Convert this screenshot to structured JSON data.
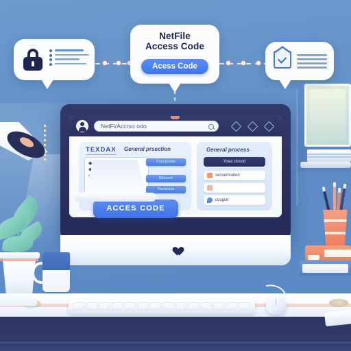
{
  "scene": {
    "title": "NetFile Access Code desk illustration",
    "colors": {
      "wall": "#6292c8",
      "bezel": "#2b3060",
      "accent_blue": "#4a7ce6",
      "dark_navy": "#20264f",
      "coral": "#ea7f5d",
      "leaf_green": "#7fcbbb"
    }
  },
  "callouts": {
    "left": {
      "name": "lock-document-callout",
      "lock_icon": "lock-icon",
      "doc_icon": "document-lines-icon"
    },
    "center": {
      "title_line_1": "NetFile",
      "title_line_2": "Access Code",
      "button_label": "Acess Code"
    },
    "right": {
      "name": "envelope-check-callout",
      "envelope_icon": "envelope-check-icon",
      "lines_icon": "text-lines-icon"
    }
  },
  "monitor": {
    "browser": {
      "avatar_icon": "user-avatar-icon",
      "url_value": "NetFi/Accrso odo",
      "url_placeholder": "Search",
      "search_icon": "search-icon",
      "toolbar_icons": [
        "diamond-icon",
        "diamond-icon",
        "diamond-icon"
      ]
    },
    "screen": {
      "left_panel": {
        "logo": "TEXDAX",
        "heading": "General prsection",
        "rows": [
          {
            "icon": "bullet-icon",
            "line": "short"
          },
          {
            "icon": "bullet-icon",
            "line": "long"
          },
          {
            "icon": "bullet-icon",
            "line": "mid"
          },
          {
            "icon": "bullet-icon",
            "line": "short"
          },
          {
            "icon": "bullet-icon",
            "line": "mid"
          }
        ],
        "buttons": [
          {
            "label": "Prauquotes"
          },
          {
            "label": "Gdooore"
          },
          {
            "label": "Porntotcts"
          }
        ]
      },
      "right_panel": {
        "heading": "General process",
        "primary_button": "Yoaa closod",
        "rows": [
          {
            "icon": "note-icon",
            "label": "servietmation",
            "color": "#ef9a73"
          },
          {
            "icon": "door-icon",
            "label": "",
            "color": "#e8b79e"
          },
          {
            "icon": "droplet-icon",
            "label": "cougial",
            "color": "#5d8fd6"
          }
        ]
      }
    },
    "cta_label": "ACCES CODE",
    "logo_icon": "heart-icon"
  },
  "desk": {
    "keyboard": {
      "name": "keyboard",
      "key_count": 14
    },
    "mouse": {
      "name": "computer-mouse"
    },
    "mug": {
      "name": "coffee-mug"
    },
    "coaster": {
      "name": "coaster"
    },
    "plant": {
      "name": "potted-plant"
    },
    "lamp": {
      "name": "desk-lamp"
    },
    "pencil_cup": {
      "name": "pencil-cup",
      "pencil_count": 4
    },
    "books": [
      {
        "name": "book-blue"
      },
      {
        "name": "book-coral"
      }
    ],
    "shelf_books": {
      "name": "shelf-books"
    },
    "wall_frame": {
      "name": "wall-picture-frame"
    }
  }
}
